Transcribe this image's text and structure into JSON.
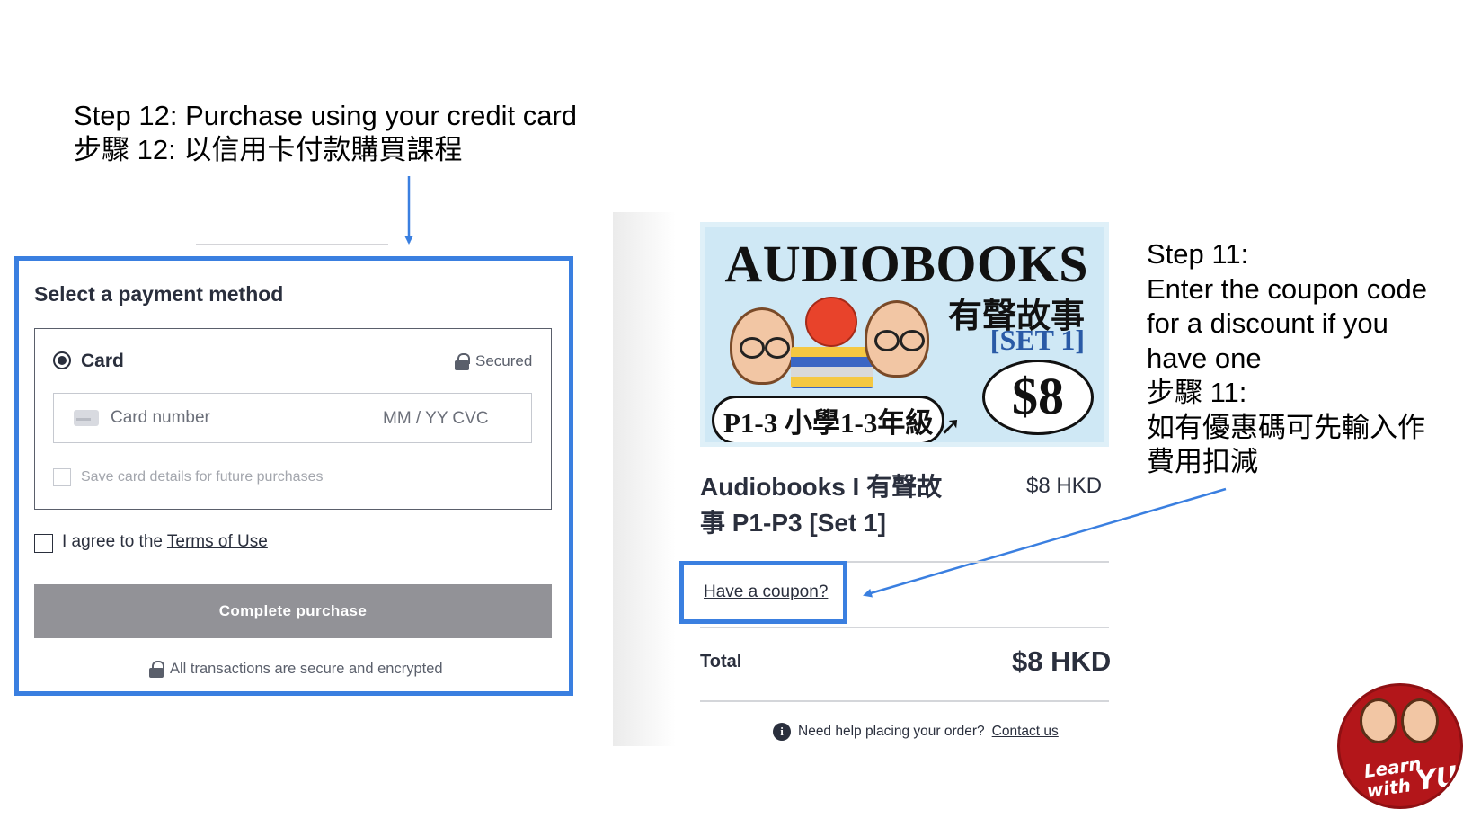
{
  "annotations": {
    "step12_en": "Step 12: Purchase using your credit card",
    "step12_zh": "步驟 12: 以信用卡付款購買課程",
    "step11_lines": [
      "Step 11:",
      "Enter the coupon code",
      "for a discount if you",
      "have one",
      "步驟 11:",
      "如有優惠碼可先輸入作",
      "費用扣減"
    ]
  },
  "payment": {
    "title": "Select a payment method",
    "card_label": "Card",
    "secured_label": "Secured",
    "card_number_placeholder": "Card number",
    "expiry_cvc_placeholder": "MM / YY  CVC",
    "save_card_label": "Save card details for future purchases",
    "agree_prefix": "I agree to the ",
    "terms_link": "Terms of Use",
    "complete_button": "Complete purchase",
    "secure_note": "All transactions are secure and encrypted"
  },
  "banner": {
    "title": "AUDIOBOOKS",
    "subtitle": "有聲故事",
    "set": "[SET 1]",
    "grade": "P1-3 小學1-3年級",
    "price": "$8"
  },
  "order": {
    "product_title": "Audiobooks I 有聲故事 P1-P3 [Set 1]",
    "product_price": "$8 HKD",
    "coupon_link": "Have a coupon?",
    "total_label": "Total",
    "total_value": "$8 HKD",
    "help_text": "Need help placing your order?",
    "help_link": "Contact us"
  },
  "logo": {
    "line1": "Learn",
    "line2_prefix": "with",
    "line2_brand": "YU"
  },
  "colors": {
    "highlight_blue": "#3a7fe0",
    "button_gray": "#929297",
    "logo_red": "#b3161a"
  }
}
